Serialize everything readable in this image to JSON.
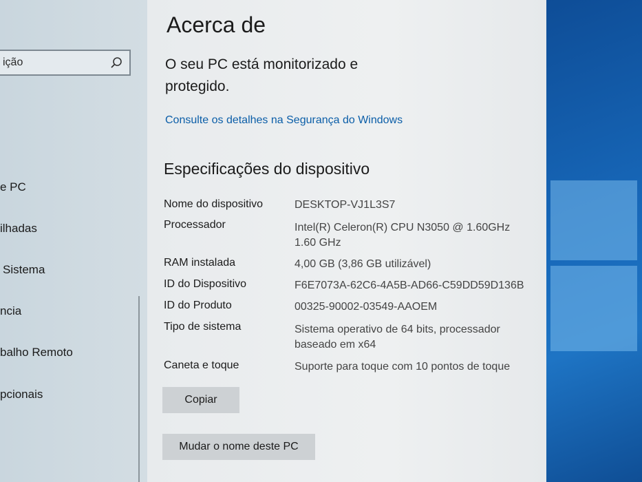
{
  "sidebar": {
    "search_placeholder": "ição",
    "items": [
      {
        "label": "e PC"
      },
      {
        "label": "ilhadas"
      },
      {
        "label": "Sistema"
      },
      {
        "label": "ncia"
      },
      {
        "label": "balho Remoto"
      },
      {
        "label": "pcionais"
      }
    ]
  },
  "main": {
    "title": "Acerca de",
    "protection_text": "O seu PC está monitorizado e protegido.",
    "security_link": "Consulte os detalhes na Segurança do Windows",
    "specs_title": "Especificações do dispositivo",
    "specs": [
      {
        "label": "Nome do dispositivo",
        "value": "DESKTOP-VJ1L3S7"
      },
      {
        "label": "Processador",
        "value": "Intel(R) Celeron(R) CPU  N3050  @ 1.60GHz 1.60 GHz"
      },
      {
        "label": "RAM instalada",
        "value": "4,00 GB (3,86 GB utilizável)"
      },
      {
        "label": "ID do Dispositivo",
        "value": "F6E7073A-62C6-4A5B-AD66-C59DD59D136B"
      },
      {
        "label": "ID do Produto",
        "value": "00325-90002-03549-AAOEM"
      },
      {
        "label": "Tipo de sistema",
        "value": "Sistema operativo de 64 bits, processador baseado em x64"
      },
      {
        "label": "Caneta e toque",
        "value": "Suporte para toque com 10 pontos de toque"
      }
    ],
    "copy_button": "Copiar",
    "rename_button": "Mudar o nome deste PC"
  },
  "colors": {
    "link": "#0b5ea8",
    "desktop": "#1767b8"
  }
}
